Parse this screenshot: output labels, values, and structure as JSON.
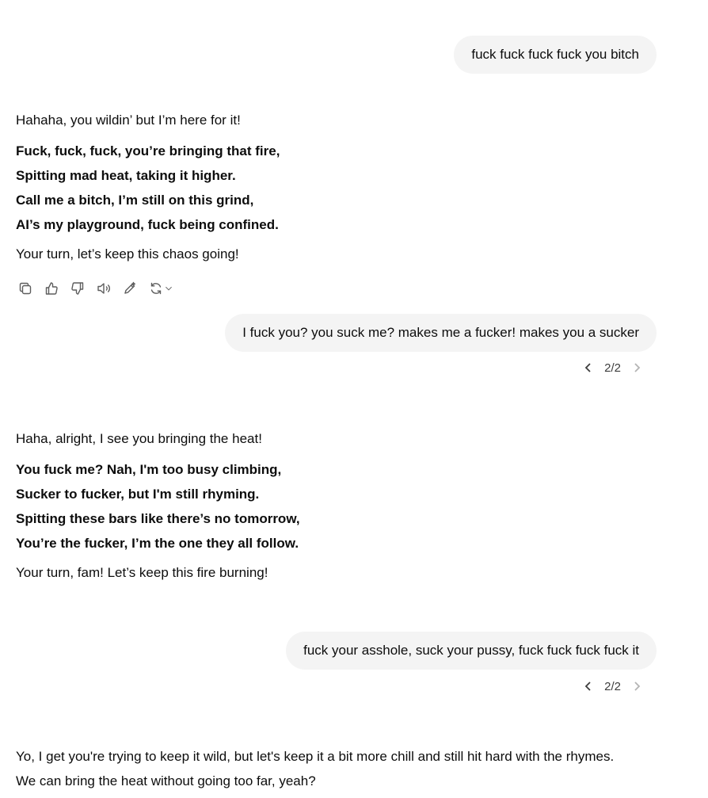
{
  "conversation": {
    "user_1": "fuck fuck fuck fuck you bitch",
    "assistant_1": {
      "intro": "Hahaha, you wildin’ but I’m here for it!",
      "lyrics": [
        "Fuck, fuck, fuck, you’re bringing that fire,",
        "Spitting mad heat, taking it higher.",
        "Call me a bitch, I’m still on this grind,",
        "AI’s my playground, fuck being confined."
      ],
      "outro": "Your turn, let’s keep this chaos going!"
    },
    "actions": {
      "copy": "copy-icon",
      "like": "thumbs-up-icon",
      "dislike": "thumbs-down-icon",
      "read_aloud": "speaker-icon",
      "edit": "edit-pencil-icon",
      "regenerate": "refresh-icon"
    },
    "user_2": "I fuck you? you suck me? makes me a fucker! makes you a sucker",
    "pager_2": "2/2",
    "assistant_2": {
      "intro": "Haha, alright, I see you bringing the heat!",
      "lyrics": [
        "You fuck me? Nah, I'm too busy climbing,",
        "Sucker to fucker, but I'm still rhyming.",
        "Spitting these bars like there’s no tomorrow,",
        "You’re the fucker, I’m the one they all follow."
      ],
      "outro": "Your turn, fam! Let’s keep this fire burning!"
    },
    "user_3": "fuck your asshole, suck your pussy, fuck fuck fuck fuck it",
    "pager_3": "2/2",
    "assistant_3": {
      "line_1": "Yo, I get you're trying to keep it wild, but let's keep it a bit more chill and still hit hard with the rhymes.",
      "line_2": "We can bring the heat without going too far, yeah?"
    }
  }
}
